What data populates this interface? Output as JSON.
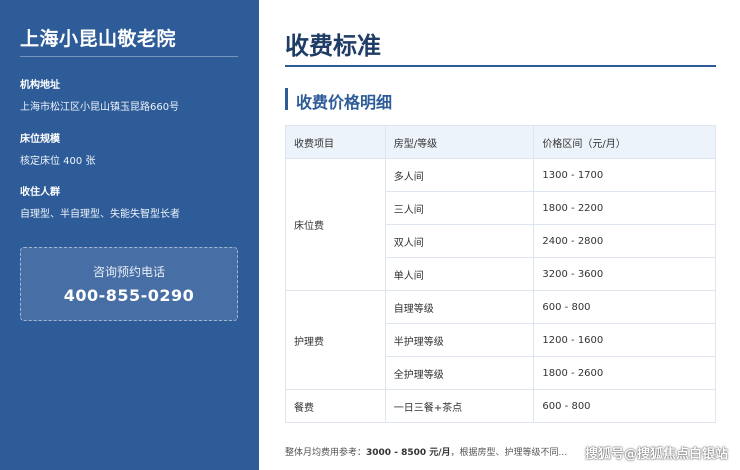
{
  "sidebar": {
    "org_name": "上海小昆山敬老院",
    "address_label": "机构地址",
    "address": "上海市松江区小昆山镇玉昆路660号",
    "beds_label": "床位规模",
    "beds": "核定床位 400 张",
    "residents_label": "收住人群",
    "residents": "自理型、半自理型、失能失智型长者",
    "phone_label": "咨询预约电话",
    "phone": "400-855-0290"
  },
  "main": {
    "page_title": "收费标准",
    "section_title": "收费价格明细",
    "table": {
      "headers": [
        "收费项目",
        "房型/等级",
        "价格区间（元/月）"
      ],
      "groups": [
        {
          "category": "床位费",
          "rows": [
            {
              "type": "多人间",
              "price": "1300 - 1700"
            },
            {
              "type": "三人间",
              "price": "1800 - 2200"
            },
            {
              "type": "双人间",
              "price": "2400 - 2800"
            },
            {
              "type": "单人间",
              "price": "3200 - 3600"
            }
          ]
        },
        {
          "category": "护理费",
          "rows": [
            {
              "type": "自理等级",
              "price": "600 - 800"
            },
            {
              "type": "半护理等级",
              "price": "1200 - 1600"
            },
            {
              "type": "全护理等级",
              "price": "1800 - 2600"
            }
          ]
        },
        {
          "category": "餐费",
          "rows": [
            {
              "type": "一日三餐+茶点",
              "price": "600 - 800"
            }
          ]
        }
      ]
    },
    "footer_prefix": "整体月均费用参考：",
    "footer_range": "3000 - 8500 元/月",
    "footer_suffix": "，根据房型、护理等级不同..."
  },
  "watermark": "搜狐号@搜狐焦点白银站",
  "colors": {
    "sidebar_bg": "#2e5c99",
    "accent": "#2e5c99",
    "title": "#1f3c66",
    "table_header_bg": "#edf3fa"
  }
}
